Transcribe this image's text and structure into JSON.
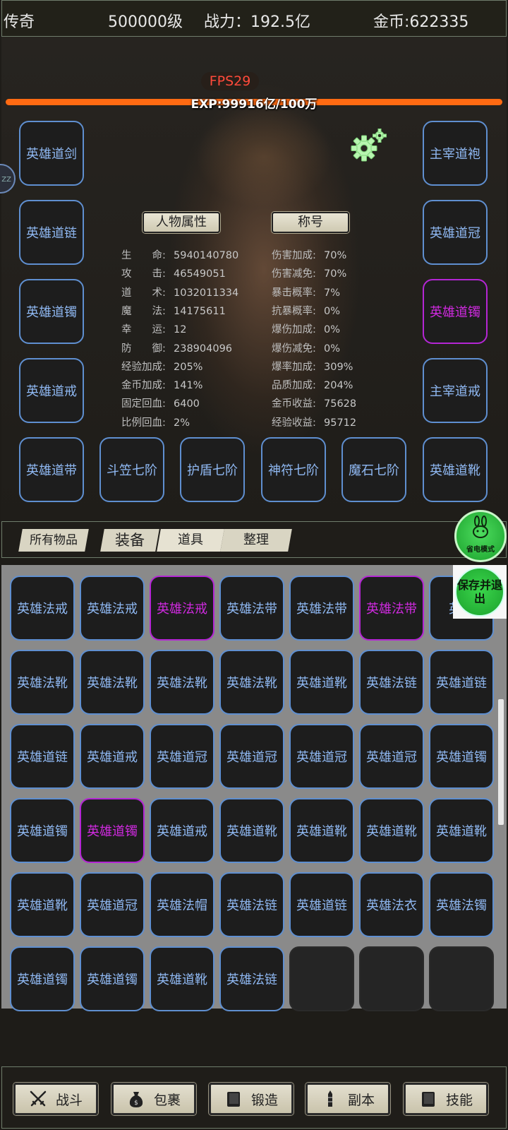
{
  "topbar": {
    "game": "传奇",
    "level": "500000级",
    "power": "战力：192.5亿",
    "gold": "金币:622335"
  },
  "hud": {
    "fps": "FPS29",
    "exp_text": "EXP:99916亿/100万",
    "exp_progress": 1.0,
    "side_bubble": "ZZ"
  },
  "equip_left": [
    "英雄道剑",
    "英雄道链",
    "英雄道镯",
    "英雄道戒",
    "英雄道带"
  ],
  "equip_right": [
    "主宰道袍",
    "英雄道冠",
    "英雄道镯",
    "主宰道戒",
    "英雄道靴"
  ],
  "equip_bottom": [
    "斗笠七阶",
    "护盾七阶",
    "神符七阶",
    "魔石七阶"
  ],
  "buttons": {
    "attributes": "人物属性",
    "title": "称号"
  },
  "stats_left": [
    {
      "label": "生　　命:",
      "value": "5940140780"
    },
    {
      "label": "攻　　击:",
      "value": "46549051"
    },
    {
      "label": "道　　术:",
      "value": "1032011334"
    },
    {
      "label": "魔　　法:",
      "value": "14175611"
    },
    {
      "label": "幸　　运:",
      "value": "12"
    },
    {
      "label": "防　　御:",
      "value": "238904096"
    },
    {
      "label": "经验加成:",
      "value": "205%"
    },
    {
      "label": "金币加成:",
      "value": "141%"
    },
    {
      "label": "固定回血:",
      "value": "6400"
    },
    {
      "label": "比例回血:",
      "value": "2%"
    }
  ],
  "stats_right": [
    {
      "label": "伤害加成:",
      "value": "70%"
    },
    {
      "label": "伤害减免:",
      "value": "70%"
    },
    {
      "label": "暴击概率:",
      "value": "7%"
    },
    {
      "label": "抗暴概率:",
      "value": "0%"
    },
    {
      "label": "爆伤加成:",
      "value": "0%"
    },
    {
      "label": "爆伤减免:",
      "value": "0%"
    },
    {
      "label": "爆率加成:",
      "value": "309%"
    },
    {
      "label": "品质加成:",
      "value": "204%"
    },
    {
      "label": "金币收益:",
      "value": "75628"
    },
    {
      "label": "经验收益:",
      "value": "95712"
    }
  ],
  "tabs": {
    "all": "所有物品",
    "equip": "装备",
    "props": "道具",
    "sort": "整理"
  },
  "power_save": "省电模式",
  "save_exit": "保存并退出",
  "inventory": [
    [
      "英雄法戒",
      "英雄法戒",
      "英雄法戒",
      "英雄法带",
      "英雄法带",
      "英雄法带",
      "英雄"
    ],
    [
      "英雄法靴",
      "英雄法靴",
      "英雄法靴",
      "英雄法靴",
      "英雄道靴",
      "英雄法链",
      "英雄道链"
    ],
    [
      "英雄道链",
      "英雄道戒",
      "英雄道冠",
      "英雄道冠",
      "英雄道冠",
      "英雄道冠",
      "英雄道镯"
    ],
    [
      "英雄道镯",
      "英雄道镯",
      "英雄道戒",
      "英雄道靴",
      "英雄道靴",
      "英雄道靴",
      "英雄道靴"
    ],
    [
      "英雄道靴",
      "英雄道冠",
      "英雄法帽",
      "英雄法链",
      "英雄道链",
      "英雄法衣",
      "英雄法镯"
    ],
    [
      "英雄道镯",
      "英雄道镯",
      "英雄道靴",
      "英雄法链",
      "",
      "",
      ""
    ]
  ],
  "inventory_purple": [
    "0-2",
    "0-5",
    "3-1"
  ],
  "nav": [
    {
      "label": "战斗",
      "icon": "crossed-swords-icon"
    },
    {
      "label": "包裹",
      "icon": "money-bag-icon"
    },
    {
      "label": "锻造",
      "icon": "book-icon"
    },
    {
      "label": "副本",
      "icon": "tower-icon"
    },
    {
      "label": "技能",
      "icon": "skill-book-icon"
    }
  ],
  "colors": {
    "slot_border": "#5f8fd0",
    "slot_text": "#8fb8f2",
    "rare_purple": "#d02ae0",
    "exp_bar": "#ff6a12",
    "fps": "#ff4a3a"
  }
}
